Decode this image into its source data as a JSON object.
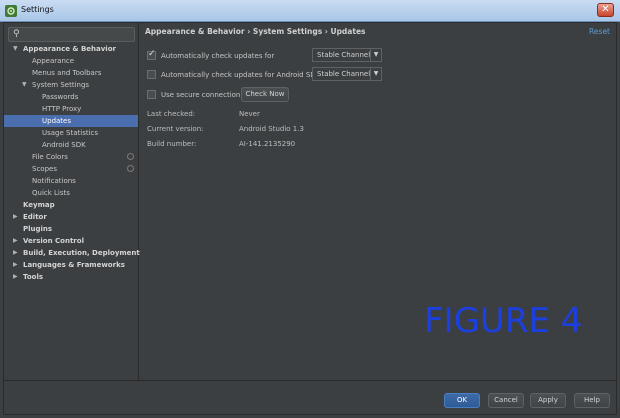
{
  "window": {
    "title": "Settings",
    "close_glyph": "✕"
  },
  "search": {
    "glyph": "⚲",
    "placeholder": ""
  },
  "sidebar": {
    "items": [
      {
        "label": "Appearance & Behavior",
        "arrow": "▼"
      },
      {
        "label": "Appearance"
      },
      {
        "label": "Menus and Toolbars"
      },
      {
        "label": "System Settings",
        "arrow": "▼"
      },
      {
        "label": "Passwords"
      },
      {
        "label": "HTTP Proxy"
      },
      {
        "label": "Updates"
      },
      {
        "label": "Usage Statistics"
      },
      {
        "label": "Android SDK"
      },
      {
        "label": "File Colors"
      },
      {
        "label": "Scopes"
      },
      {
        "label": "Notifications"
      },
      {
        "label": "Quick Lists"
      },
      {
        "label": "Keymap"
      },
      {
        "label": "Editor",
        "arrow": "▶"
      },
      {
        "label": "Plugins"
      },
      {
        "label": "Version Control",
        "arrow": "▶"
      },
      {
        "label": "Build, Execution, Deployment",
        "arrow": "▶"
      },
      {
        "label": "Languages & Frameworks",
        "arrow": "▶"
      },
      {
        "label": "Tools",
        "arrow": "▶"
      }
    ],
    "selected": "Updates"
  },
  "content": {
    "breadcrumb": "Appearance & Behavior › System Settings › Updates",
    "reset_label": "Reset",
    "auto_check": {
      "label": "Automatically check updates for",
      "checked": true,
      "channel": "Stable Channel"
    },
    "auto_check_sdk": {
      "label": "Automatically check updates for Android SDK",
      "checked": false,
      "channel": "Stable Channel"
    },
    "secure_connection": {
      "label": "Use secure connection",
      "checked": false
    },
    "check_now_label": "Check Now",
    "info": [
      {
        "label": "Last checked:",
        "value": "Never"
      },
      {
        "label": "Current version:",
        "value": "Android Studio 1.3"
      },
      {
        "label": "Build number:",
        "value": "AI-141.2135290"
      }
    ]
  },
  "watermark": "FIGURE 4",
  "buttons": {
    "ok": "OK",
    "cancel": "Cancel",
    "apply": "Apply",
    "help": "Help"
  },
  "colors": {
    "selection": "#4b6eaf",
    "link": "#5b9bd5",
    "watermark": "#1c3fe0",
    "background": "#3c3f41"
  },
  "icons": {
    "dropdown": "▼"
  }
}
